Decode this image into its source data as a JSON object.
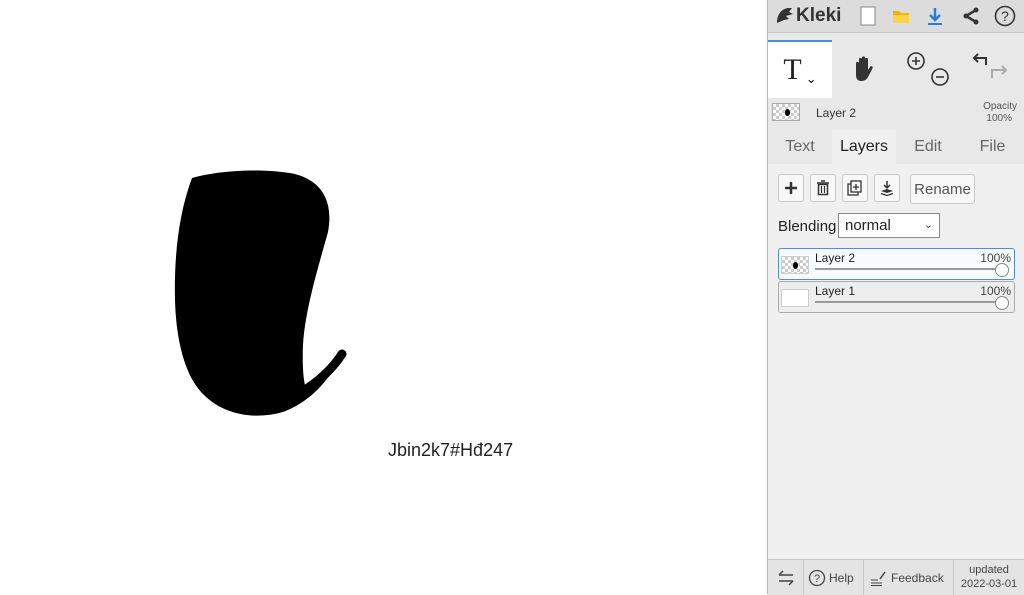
{
  "app": {
    "name": "Kleki"
  },
  "canvas": {
    "text": "Jbin2k7#Hđ247",
    "colors": {
      "fill": "#000000",
      "background": "#ffffff"
    }
  },
  "toolbar": {
    "icons": [
      "new-document-icon",
      "open-folder-icon",
      "download-icon",
      "share-icon",
      "help-icon"
    ]
  },
  "tools": {
    "text_tool_label": "T"
  },
  "layer_info": {
    "name": "Layer 2",
    "opacity_label": "Opacity",
    "opacity_value": "100%"
  },
  "tabs": [
    {
      "label": "Text"
    },
    {
      "label": "Layers"
    },
    {
      "label": "Edit"
    },
    {
      "label": "File"
    }
  ],
  "active_tab": "Layers",
  "layers_panel": {
    "rename_label": "Rename",
    "blending_label": "Blending",
    "blending_value": "normal",
    "layers": [
      {
        "name": "Layer 2",
        "opacity": "100%",
        "selected": true
      },
      {
        "name": "Layer 1",
        "opacity": "100%",
        "selected": false
      }
    ]
  },
  "footer": {
    "help_label": "Help",
    "feedback_label": "Feedback",
    "updated_label": "updated",
    "updated_date": "2022-03-01"
  },
  "colors": {
    "accent": "#4a90d9",
    "download": "#2a7ad9",
    "folder": "#f0b400"
  }
}
